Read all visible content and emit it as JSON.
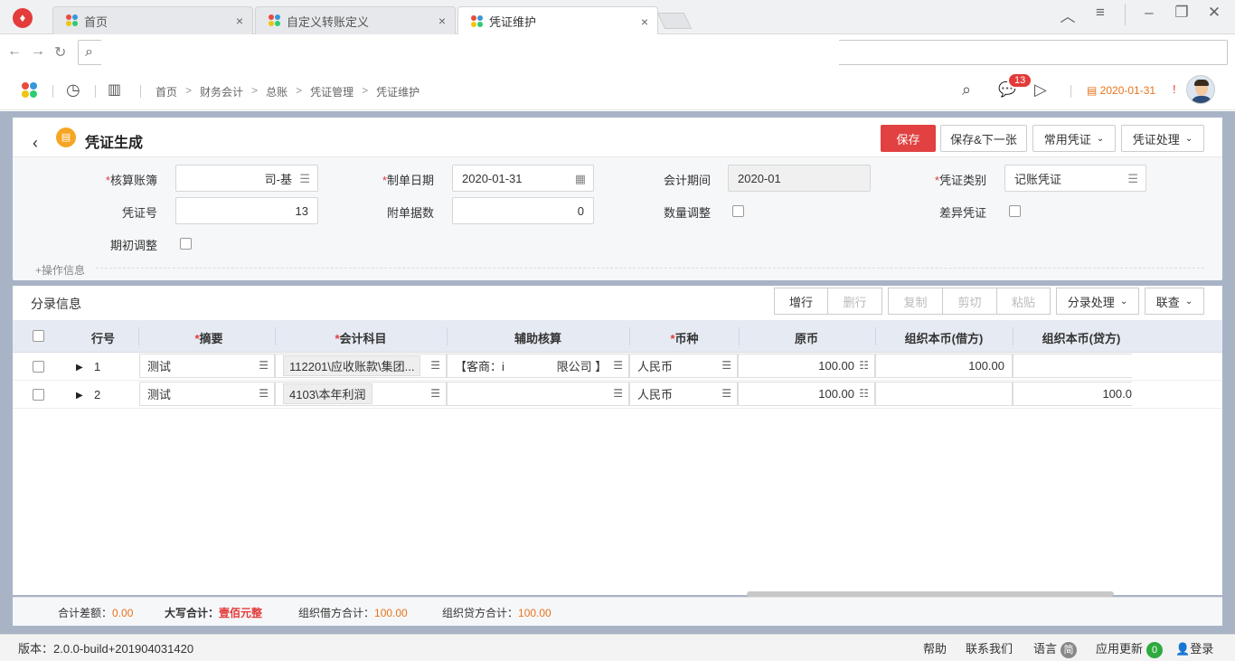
{
  "browser": {
    "tabs": [
      {
        "title": "首页"
      },
      {
        "title": "自定义转账定义"
      },
      {
        "title": "凭证维护"
      }
    ],
    "close_glyph": "×"
  },
  "header": {
    "breadcrumbs": [
      "首页",
      "财务会计",
      "总账",
      "凭证管理",
      "凭证维护"
    ],
    "notifications": "13",
    "date": "2020-01-31",
    "warn": "!"
  },
  "voucher": {
    "title": "凭证生成",
    "buttons": {
      "save": "保存",
      "save_next": "保存&下一张",
      "common": "常用凭证",
      "process": "凭证处理"
    },
    "fields": {
      "book_label": "核算账簿",
      "book_value": "司-基",
      "date_label": "制单日期",
      "date_value": "2020-01-31",
      "period_label": "会计期间",
      "period_value": "2020-01",
      "type_label": "凭证类别",
      "type_value": "记账凭证",
      "no_label": "凭证号",
      "no_value": "13",
      "attach_label": "附单据数",
      "attach_value": "0",
      "qty_label": "数量调整",
      "diff_label": "差异凭证",
      "init_label": "期初调整"
    },
    "ops_info": "+操作信息"
  },
  "entries": {
    "title": "分录信息",
    "buttons": {
      "add": "增行",
      "del": "删行",
      "copy": "复制",
      "cut": "剪切",
      "paste": "粘贴",
      "process": "分录处理",
      "link": "联查"
    },
    "columns": {
      "rownum": "行号",
      "summary": "摘要",
      "account": "会计科目",
      "aux": "辅助核算",
      "currency": "币种",
      "orig": "原币",
      "debit": "组织本币(借方)",
      "credit": "组织本币(贷方)"
    },
    "rows": [
      {
        "no": "1",
        "summary": "测试",
        "account": "112201\\应收账款\\集团...",
        "aux": "【客商：i                限公司 】",
        "currency": "人民币",
        "orig": "100.00",
        "debit": "100.00",
        "credit": ""
      },
      {
        "no": "2",
        "summary": "测试",
        "account": "4103\\本年利润",
        "aux": "",
        "currency": "人民币",
        "orig": "100.00",
        "debit": "",
        "credit": "100.0"
      }
    ]
  },
  "totals": {
    "diff_label": "合计差额：",
    "diff_value": "0.00",
    "upper_label": "大写合计：",
    "upper_value": "壹佰元整",
    "debit_label": "组织借方合计：",
    "debit_value": "100.00",
    "credit_label": "组织贷方合计：",
    "credit_value": "100.00"
  },
  "status": {
    "version": "版本：2.0.0-build+201904031420",
    "help": "帮助",
    "contact": "联系我们",
    "lang": "语言",
    "lang_badge": "简",
    "update": "应用更新",
    "update_badge": "0",
    "login": "登录"
  },
  "colors": {
    "primary": "#e14141",
    "accent": "#e8731c"
  }
}
